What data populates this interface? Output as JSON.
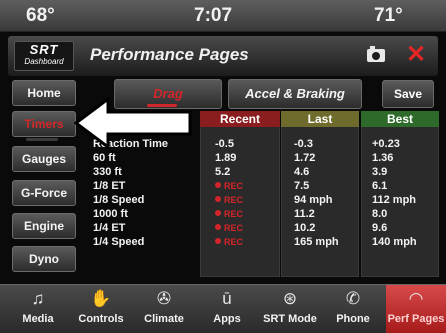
{
  "statusbar": {
    "temp_left": "68°",
    "time": "7:07",
    "temp_right": "71°"
  },
  "header": {
    "logo_line1": "SRT",
    "logo_line2": "Dashboard",
    "title": "Performance Pages"
  },
  "sidebar": {
    "items": [
      {
        "label": "Home",
        "active": false
      },
      {
        "label": "Timers",
        "active": true
      },
      {
        "label": "Gauges",
        "active": false
      },
      {
        "label": "G-Force",
        "active": false
      },
      {
        "label": "Engine",
        "active": false
      },
      {
        "label": "Dyno",
        "active": false
      }
    ]
  },
  "tabs": [
    {
      "label": "Drag",
      "active": true
    },
    {
      "label": "Accel & Braking",
      "active": false
    }
  ],
  "save_label": "Save",
  "table": {
    "headers": [
      "Recent",
      "Last",
      "Best"
    ],
    "rows": [
      {
        "label": "Reaction Time",
        "recent": "-0.5",
        "last": "-0.3",
        "best": "+0.23"
      },
      {
        "label": "60 ft",
        "recent": "1.89",
        "last": "1.72",
        "best": "1.36"
      },
      {
        "label": "330 ft",
        "recent": "5.2",
        "last": "4.6",
        "best": "3.9"
      },
      {
        "label": "1/8 ET",
        "recent": "REC",
        "last": "7.5",
        "best": "6.1"
      },
      {
        "label": "1/8 Speed",
        "recent": "REC",
        "last": "94 mph",
        "best": "112 mph"
      },
      {
        "label": "1000 ft",
        "recent": "REC",
        "last": "11.2",
        "best": "8.0"
      },
      {
        "label": "1/4 ET",
        "recent": "REC",
        "last": "10.2",
        "best": "9.6"
      },
      {
        "label": "1/4 Speed",
        "recent": "REC",
        "last": "165 mph",
        "best": "140 mph"
      }
    ]
  },
  "bottom_nav": [
    {
      "label": "Media",
      "icon": "music-note-icon",
      "active": false
    },
    {
      "label": "Controls",
      "icon": "hand-icon",
      "active": false
    },
    {
      "label": "Climate",
      "icon": "fan-icon",
      "active": false
    },
    {
      "label": "Apps",
      "icon": "apps-icon",
      "active": false
    },
    {
      "label": "SRT Mode",
      "icon": "steering-wheel-icon",
      "active": false
    },
    {
      "label": "Phone",
      "icon": "phone-signal-icon",
      "active": false
    },
    {
      "label": "Perf Pages",
      "icon": "gauge-icon",
      "active": true
    }
  ],
  "colors": {
    "accent_red": "#d3262a",
    "recent_header": "#8a1d1d",
    "last_header": "#6e6b2d",
    "best_header": "#2e6a2a"
  }
}
